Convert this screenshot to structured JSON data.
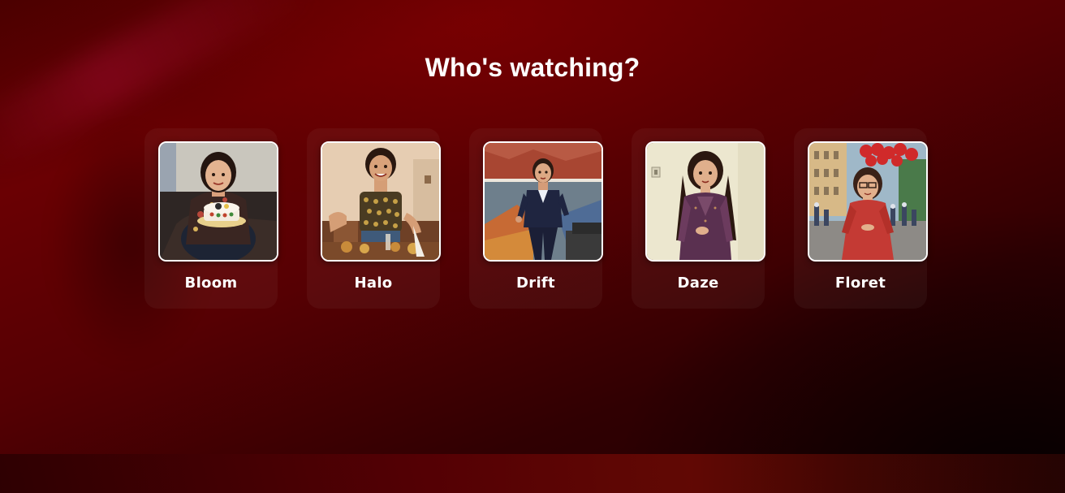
{
  "page": {
    "title": "Who's watching?"
  },
  "profiles": [
    {
      "name": "Bloom",
      "avatar_icon": "woman-with-cake-avatar"
    },
    {
      "name": "Halo",
      "avatar_icon": "woman-in-patterned-top-avatar"
    },
    {
      "name": "Drift",
      "avatar_icon": "woman-in-suit-avatar"
    },
    {
      "name": "Daze",
      "avatar_icon": "woman-in-purple-dress-avatar"
    },
    {
      "name": "Floret",
      "avatar_icon": "woman-with-balloons-avatar"
    }
  ],
  "colors": {
    "background_primary": "#5a0003",
    "background_dark": "#1c0102",
    "text": "#ffffff",
    "avatar_border": "#ffffff"
  }
}
